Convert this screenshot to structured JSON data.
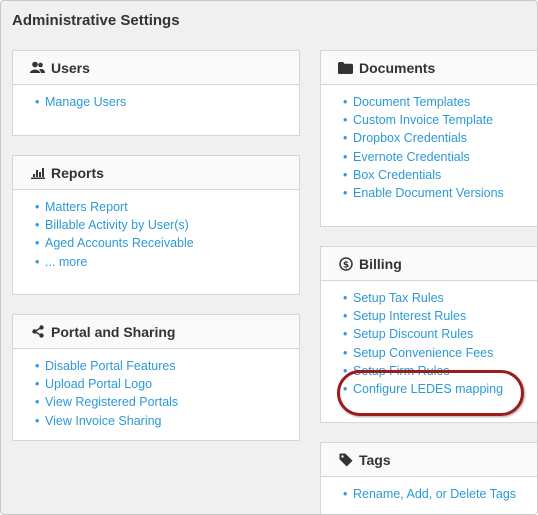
{
  "page": {
    "title": "Administrative Settings"
  },
  "colors": {
    "link": "#2c9ad6",
    "highlight": "#9e1b1b"
  },
  "panels": {
    "users": {
      "title": "Users",
      "icon": "users-icon",
      "items": [
        "Manage Users"
      ]
    },
    "reports": {
      "title": "Reports",
      "icon": "bar-chart-icon",
      "items": [
        "Matters Report",
        "Billable Activity by User(s)",
        "Aged Accounts Receivable",
        "... more"
      ]
    },
    "portal": {
      "title": "Portal and Sharing",
      "icon": "share-icon",
      "items": [
        "Disable Portal Features",
        "Upload Portal Logo",
        "View Registered Portals",
        "View Invoice Sharing"
      ]
    },
    "documents": {
      "title": "Documents",
      "icon": "folder-icon",
      "items": [
        "Document Templates",
        "Custom Invoice Template",
        "Dropbox Credentials",
        "Evernote Credentials",
        "Box Credentials",
        "Enable Document Versions"
      ]
    },
    "billing": {
      "title": "Billing",
      "icon": "dollar-circle-icon",
      "items": [
        "Setup Tax Rules",
        "Setup Interest Rules",
        "Setup Discount Rules",
        "Setup Convenience Fees",
        "Setup Firm Rules",
        "Configure LEDES mapping"
      ]
    },
    "tags": {
      "title": "Tags",
      "icon": "tag-icon",
      "items": [
        "Rename, Add, or Delete Tags"
      ]
    }
  }
}
